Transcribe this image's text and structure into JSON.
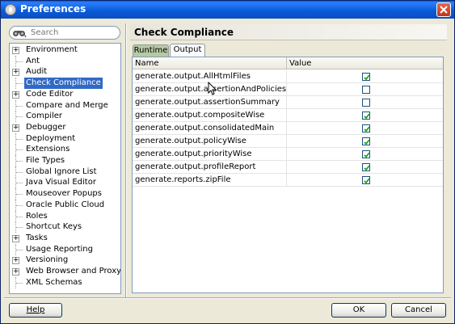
{
  "window": {
    "title": "Preferences"
  },
  "search": {
    "placeholder": "Search"
  },
  "tree": [
    {
      "label": "Environment",
      "expandable": true
    },
    {
      "label": "Ant",
      "expandable": false
    },
    {
      "label": "Audit",
      "expandable": true
    },
    {
      "label": "Check Compliance",
      "expandable": false,
      "selected": true
    },
    {
      "label": "Code Editor",
      "expandable": true
    },
    {
      "label": "Compare and Merge",
      "expandable": false
    },
    {
      "label": "Compiler",
      "expandable": false
    },
    {
      "label": "Debugger",
      "expandable": true
    },
    {
      "label": "Deployment",
      "expandable": false
    },
    {
      "label": "Extensions",
      "expandable": false
    },
    {
      "label": "File Types",
      "expandable": false
    },
    {
      "label": "Global Ignore List",
      "expandable": false
    },
    {
      "label": "Java Visual Editor",
      "expandable": false
    },
    {
      "label": "Mouseover Popups",
      "expandable": false
    },
    {
      "label": "Oracle Public Cloud",
      "expandable": false
    },
    {
      "label": "Roles",
      "expandable": false
    },
    {
      "label": "Shortcut Keys",
      "expandable": false
    },
    {
      "label": "Tasks",
      "expandable": true
    },
    {
      "label": "Usage Reporting",
      "expandable": false
    },
    {
      "label": "Versioning",
      "expandable": true
    },
    {
      "label": "Web Browser and Proxy",
      "expandable": true
    },
    {
      "label": "XML Schemas",
      "expandable": false
    }
  ],
  "main": {
    "title": "Check Compliance",
    "tabs": [
      {
        "label": "Runtime",
        "active": false
      },
      {
        "label": "Output",
        "active": true
      }
    ],
    "columns": {
      "name": "Name",
      "value": "Value"
    },
    "rows": [
      {
        "name": "generate.output.AllHtmlFiles",
        "checked": true
      },
      {
        "name": "generate.output.assertionAndPoliciesHtml",
        "checked": false
      },
      {
        "name": "generate.output.assertionSummary",
        "checked": false
      },
      {
        "name": "generate.output.compositeWise",
        "checked": true
      },
      {
        "name": "generate.output.consolidatedMain",
        "checked": true
      },
      {
        "name": "generate.output.policyWise",
        "checked": true
      },
      {
        "name": "generate.output.priorityWise",
        "checked": true
      },
      {
        "name": "generate.output.profileReport",
        "checked": true
      },
      {
        "name": "generate.reports.zipFile",
        "checked": true
      }
    ]
  },
  "buttons": {
    "help": "Help",
    "ok": "OK",
    "cancel": "Cancel"
  }
}
